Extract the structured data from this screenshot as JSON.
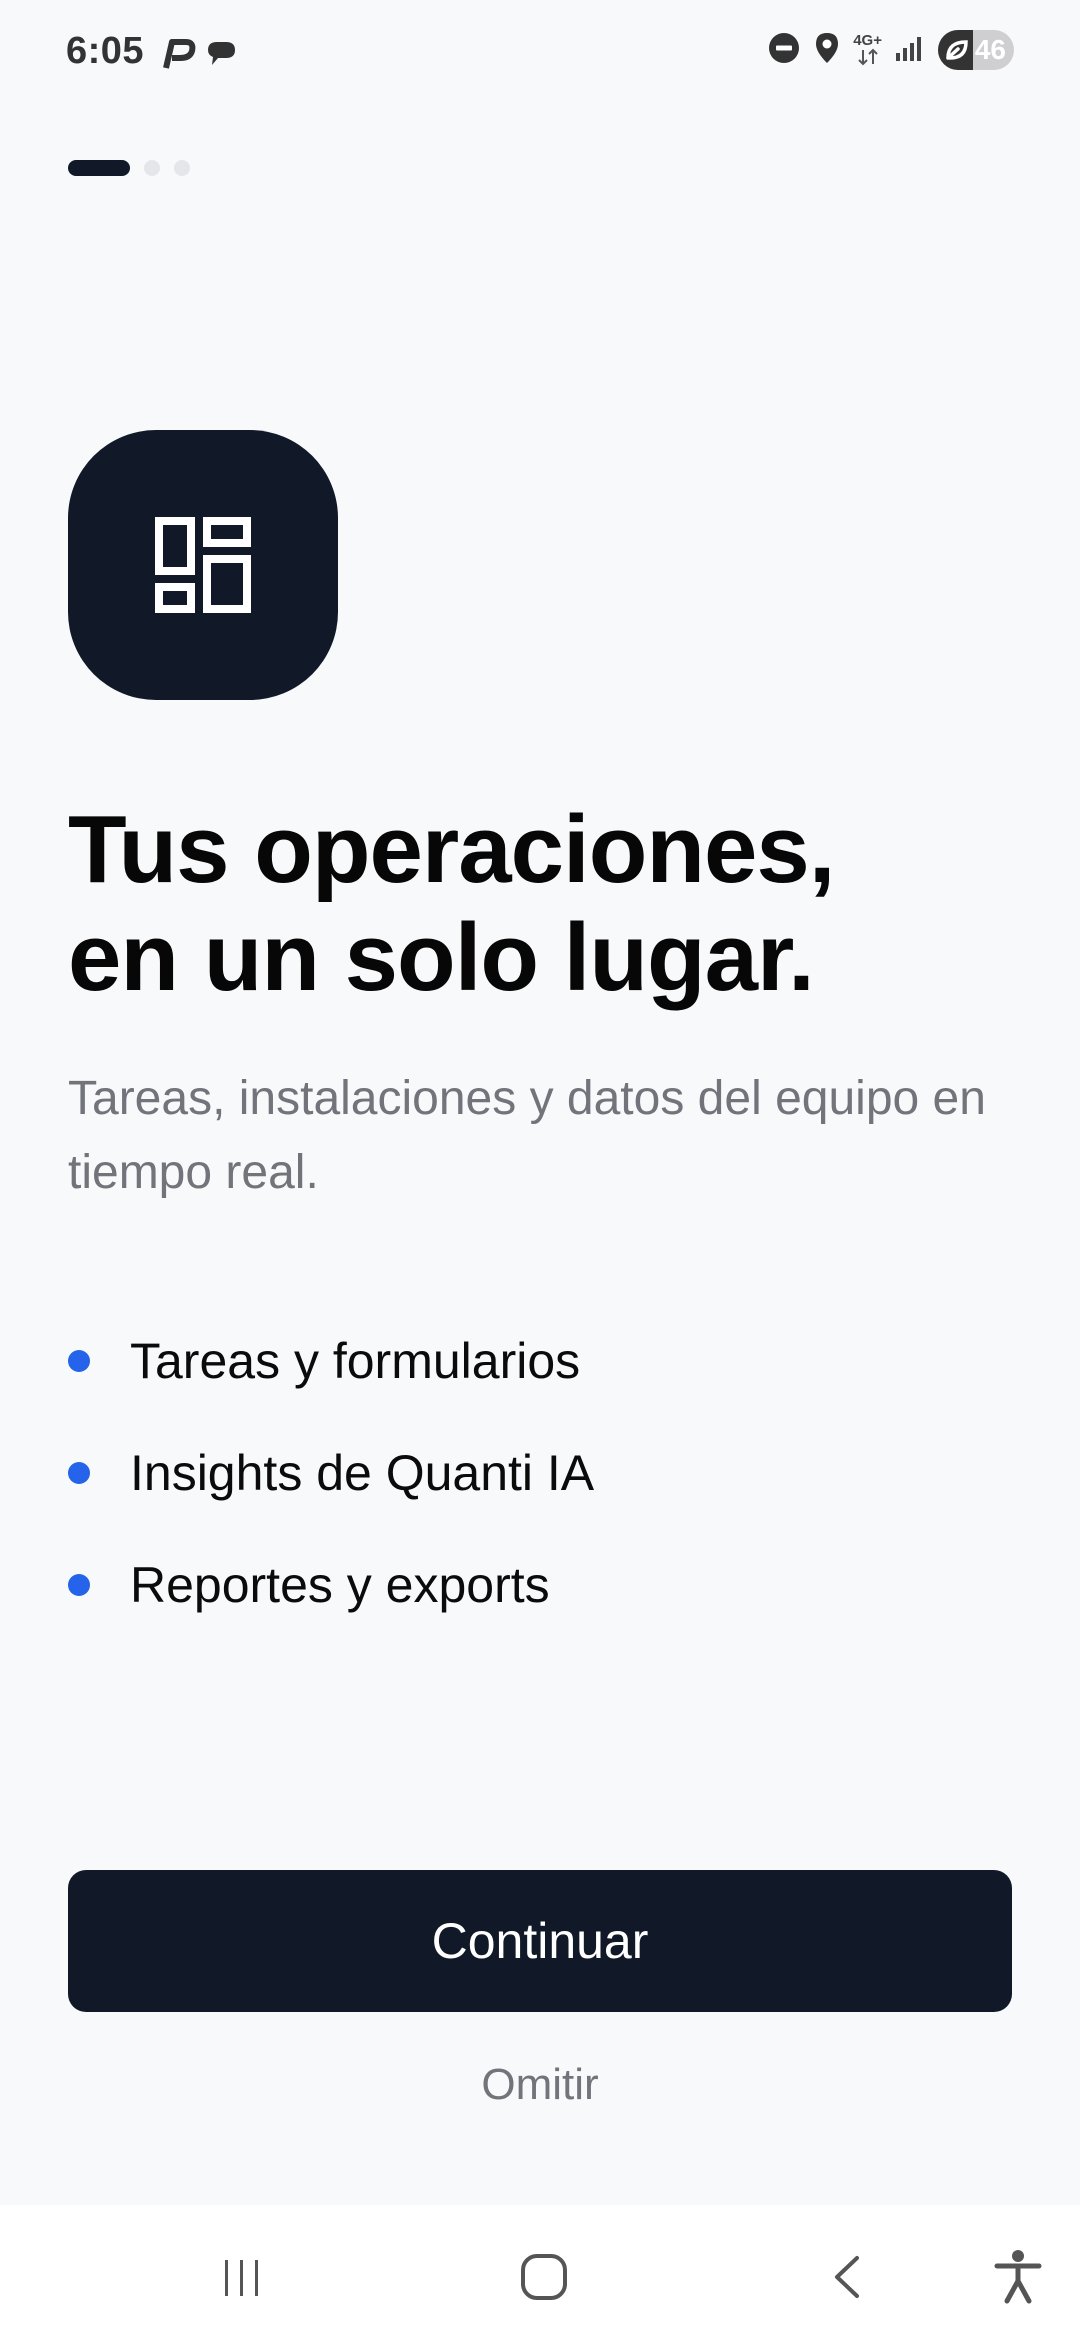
{
  "status_bar": {
    "time": "6:05",
    "network": "4G+",
    "battery": "46",
    "icons": [
      "p-app-icon",
      "chat-bubble-icon",
      "do-not-disturb-icon",
      "location-icon",
      "network-4g-icon",
      "signal-icon",
      "battery-saver-icon"
    ]
  },
  "pager": {
    "total": 3,
    "active": 0
  },
  "hero": {
    "icon": "dashboard-icon",
    "headline_line1": "Tus operaciones,",
    "headline_line2": "en un solo lugar.",
    "subtitle": "Tareas, instalaciones y datos del equipo en tiempo real."
  },
  "features": [
    {
      "label": "Tareas y formularios"
    },
    {
      "label": "Insights de Quanti IA"
    },
    {
      "label": "Reportes y exports"
    }
  ],
  "actions": {
    "continue_label": "Continuar",
    "skip_label": "Omitir"
  },
  "colors": {
    "primary": "#111827",
    "accent": "#2563eb",
    "background": "#f8f9fb",
    "muted_text": "#71747a"
  },
  "nav_bar": {
    "icons": [
      "recents-icon",
      "home-icon",
      "back-icon",
      "accessibility-icon"
    ]
  }
}
